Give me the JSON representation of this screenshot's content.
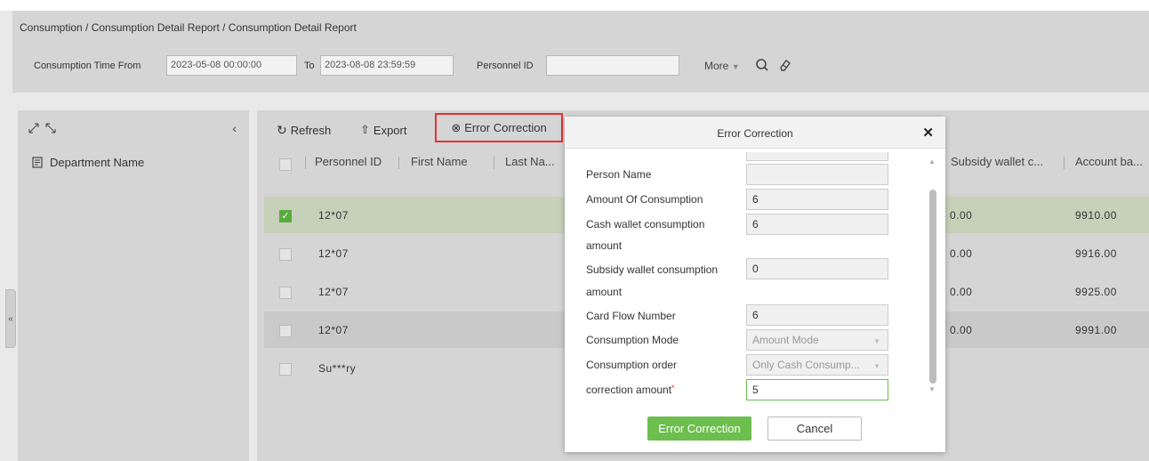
{
  "breadcrumb": "Consumption / Consumption Detail Report / Consumption Detail Report",
  "search": {
    "time_from_label": "Consumption Time From",
    "time_from_value": "2023-05-08 00:00:00",
    "to_label": "To",
    "to_value": "2023-08-08 23:59:59",
    "personnel_label": "Personnel ID",
    "personnel_value": "",
    "more_label": "More"
  },
  "left_panel": {
    "dept_label": "Department Name"
  },
  "toolbar": {
    "refresh": "Refresh",
    "export": "Export",
    "error_correction": "Error Correction"
  },
  "table": {
    "headers": {
      "personnel_id": "Personnel ID",
      "first_name": "First Name",
      "last_name": "Last Na...",
      "subsidy_wallet": "Subsidy wallet c...",
      "account_balance": "Account ba..."
    },
    "rows": [
      {
        "id": "12*07",
        "subsidy": "0.00",
        "balance": "9910.00",
        "checked": true
      },
      {
        "id": "12*07",
        "subsidy": "0.00",
        "balance": "9916.00",
        "checked": false
      },
      {
        "id": "12*07",
        "subsidy": "0.00",
        "balance": "9925.00",
        "checked": false
      },
      {
        "id": "12*07",
        "subsidy": "0.00",
        "balance": "9991.00",
        "checked": false
      },
      {
        "id": "Su***ry",
        "subsidy": "",
        "balance": "",
        "checked": false
      }
    ]
  },
  "dialog": {
    "title": "Error Correction",
    "fields": {
      "person_name_label": "Person Name",
      "person_name_value": "",
      "amount_label": "Amount Of Consumption",
      "amount_value": "6",
      "cash_label_1": "Cash wallet consumption",
      "cash_label_2": "amount",
      "cash_value": "6",
      "subsidy_label_1": "Subsidy wallet consumption",
      "subsidy_label_2": "amount",
      "subsidy_value": "0",
      "flow_label": "Card Flow Number",
      "flow_value": "6",
      "mode_label": "Consumption Mode",
      "mode_value": "Amount Mode",
      "order_label": "Consumption order",
      "order_value": "Only Cash Consump...",
      "correction_label": "correction amount",
      "correction_value": "5"
    },
    "ok_label": "Error Correction",
    "cancel_label": "Cancel"
  }
}
